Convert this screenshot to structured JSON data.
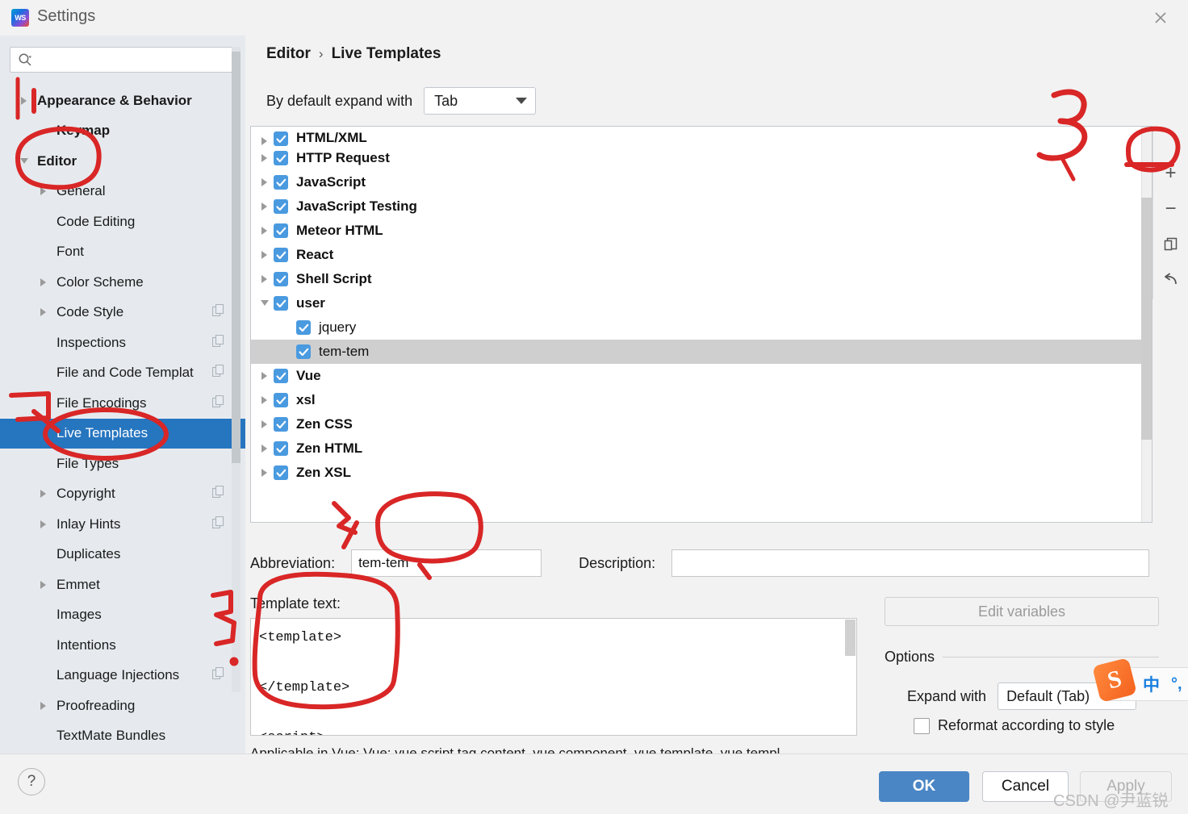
{
  "window": {
    "title": "Settings",
    "app_icon": "webstorm-logo-icon",
    "close_icon": "close-icon"
  },
  "search": {
    "value": "",
    "placeholder": "",
    "icon": "search-icon"
  },
  "sidebar": {
    "items": [
      {
        "label": "Appearance & Behavior",
        "arrow": "right",
        "bold": true,
        "indent": 0,
        "copy": false,
        "selected": false
      },
      {
        "label": "Keymap",
        "arrow": "none",
        "bold": true,
        "indent": 1,
        "copy": false,
        "selected": false
      },
      {
        "label": "Editor",
        "arrow": "down",
        "bold": true,
        "indent": 0,
        "copy": false,
        "selected": false
      },
      {
        "label": "General",
        "arrow": "right",
        "bold": false,
        "indent": 1,
        "copy": false,
        "selected": false
      },
      {
        "label": "Code Editing",
        "arrow": "none",
        "bold": false,
        "indent": 1,
        "copy": false,
        "selected": false
      },
      {
        "label": "Font",
        "arrow": "none",
        "bold": false,
        "indent": 1,
        "copy": false,
        "selected": false
      },
      {
        "label": "Color Scheme",
        "arrow": "right",
        "bold": false,
        "indent": 1,
        "copy": false,
        "selected": false
      },
      {
        "label": "Code Style",
        "arrow": "right",
        "bold": false,
        "indent": 1,
        "copy": true,
        "selected": false
      },
      {
        "label": "Inspections",
        "arrow": "none",
        "bold": false,
        "indent": 1,
        "copy": true,
        "selected": false
      },
      {
        "label": "File and Code Templat",
        "arrow": "none",
        "bold": false,
        "indent": 1,
        "copy": true,
        "selected": false
      },
      {
        "label": "File Encodings",
        "arrow": "none",
        "bold": false,
        "indent": 1,
        "copy": true,
        "selected": false
      },
      {
        "label": "Live Templates",
        "arrow": "none",
        "bold": false,
        "indent": 1,
        "copy": false,
        "selected": true
      },
      {
        "label": "File Types",
        "arrow": "none",
        "bold": false,
        "indent": 1,
        "copy": false,
        "selected": false
      },
      {
        "label": "Copyright",
        "arrow": "right",
        "bold": false,
        "indent": 1,
        "copy": true,
        "selected": false
      },
      {
        "label": "Inlay Hints",
        "arrow": "right",
        "bold": false,
        "indent": 1,
        "copy": true,
        "selected": false
      },
      {
        "label": "Duplicates",
        "arrow": "none",
        "bold": false,
        "indent": 1,
        "copy": false,
        "selected": false
      },
      {
        "label": "Emmet",
        "arrow": "right",
        "bold": false,
        "indent": 1,
        "copy": false,
        "selected": false
      },
      {
        "label": "Images",
        "arrow": "none",
        "bold": false,
        "indent": 1,
        "copy": false,
        "selected": false
      },
      {
        "label": "Intentions",
        "arrow": "none",
        "bold": false,
        "indent": 1,
        "copy": false,
        "selected": false
      },
      {
        "label": "Language Injections",
        "arrow": "none",
        "bold": false,
        "indent": 1,
        "copy": true,
        "selected": false
      },
      {
        "label": "Proofreading",
        "arrow": "right",
        "bold": false,
        "indent": 1,
        "copy": false,
        "selected": false
      },
      {
        "label": "TextMate Bundles",
        "arrow": "none",
        "bold": false,
        "indent": 1,
        "copy": false,
        "selected": false
      }
    ]
  },
  "main": {
    "breadcrumb": {
      "root": "Editor",
      "separator": "›",
      "leaf": "Live Templates"
    },
    "expand_with": {
      "label": "By default expand with",
      "value": "Tab"
    },
    "template_tree": [
      {
        "label": "HTML/XML",
        "arrow": "right",
        "group": true,
        "checked": true,
        "selected": false,
        "clipped": true
      },
      {
        "label": "HTTP Request",
        "arrow": "right",
        "group": true,
        "checked": true,
        "selected": false
      },
      {
        "label": "JavaScript",
        "arrow": "right",
        "group": true,
        "checked": true,
        "selected": false
      },
      {
        "label": "JavaScript Testing",
        "arrow": "right",
        "group": true,
        "checked": true,
        "selected": false
      },
      {
        "label": "Meteor HTML",
        "arrow": "right",
        "group": true,
        "checked": true,
        "selected": false
      },
      {
        "label": "React",
        "arrow": "right",
        "group": true,
        "checked": true,
        "selected": false
      },
      {
        "label": "Shell Script",
        "arrow": "right",
        "group": true,
        "checked": true,
        "selected": false
      },
      {
        "label": "user",
        "arrow": "down",
        "group": true,
        "checked": true,
        "selected": false
      },
      {
        "label": "jquery",
        "arrow": "none",
        "group": false,
        "checked": true,
        "selected": false,
        "child": true
      },
      {
        "label": "tem-tem",
        "arrow": "none",
        "group": false,
        "checked": true,
        "selected": true,
        "child": true
      },
      {
        "label": "Vue",
        "arrow": "right",
        "group": true,
        "checked": true,
        "selected": false
      },
      {
        "label": "xsl",
        "arrow": "right",
        "group": true,
        "checked": true,
        "selected": false
      },
      {
        "label": "Zen CSS",
        "arrow": "right",
        "group": true,
        "checked": true,
        "selected": false
      },
      {
        "label": "Zen HTML",
        "arrow": "right",
        "group": true,
        "checked": true,
        "selected": false
      },
      {
        "label": "Zen XSL",
        "arrow": "right",
        "group": true,
        "checked": true,
        "selected": false
      }
    ],
    "toolbar": [
      {
        "name": "add-template-button",
        "glyph": "+"
      },
      {
        "name": "remove-template-button",
        "glyph": "−"
      },
      {
        "name": "duplicate-template-button",
        "glyph": "copy-icon"
      },
      {
        "name": "revert-template-button",
        "glyph": "undo-icon"
      }
    ],
    "abbreviation": {
      "label": "Abbreviation:",
      "value": "tem-tem"
    },
    "description": {
      "label": "Description:",
      "value": ""
    },
    "template_text": {
      "label": "Template text:",
      "value": "<template>\n\n</template>\n\n<script>"
    },
    "applicable": "Applicable in Vue; Vue: vue script tag content, vue component, vue template, vue templ",
    "edit_variables": "Edit variables",
    "options": {
      "title": "Options",
      "expand_with_label": "Expand with",
      "expand_with_value": "Default (Tab)",
      "reformat_label": "Reformat according to style",
      "reformat_checked": false
    }
  },
  "footer": {
    "help_glyph": "?",
    "ok": "OK",
    "cancel": "Cancel",
    "apply": "Apply",
    "watermark": "CSDN @尹蓝锐"
  },
  "ime": {
    "logo": "sogou-logo-icon",
    "logo_letter": "S",
    "mode": "中",
    "punctuation": "°,"
  },
  "annotations": {
    "marker_1": "1",
    "marker_2": "2",
    "marker_3": "3",
    "marker_4": "4",
    "marker_5": "5",
    "color": "#D92626"
  }
}
